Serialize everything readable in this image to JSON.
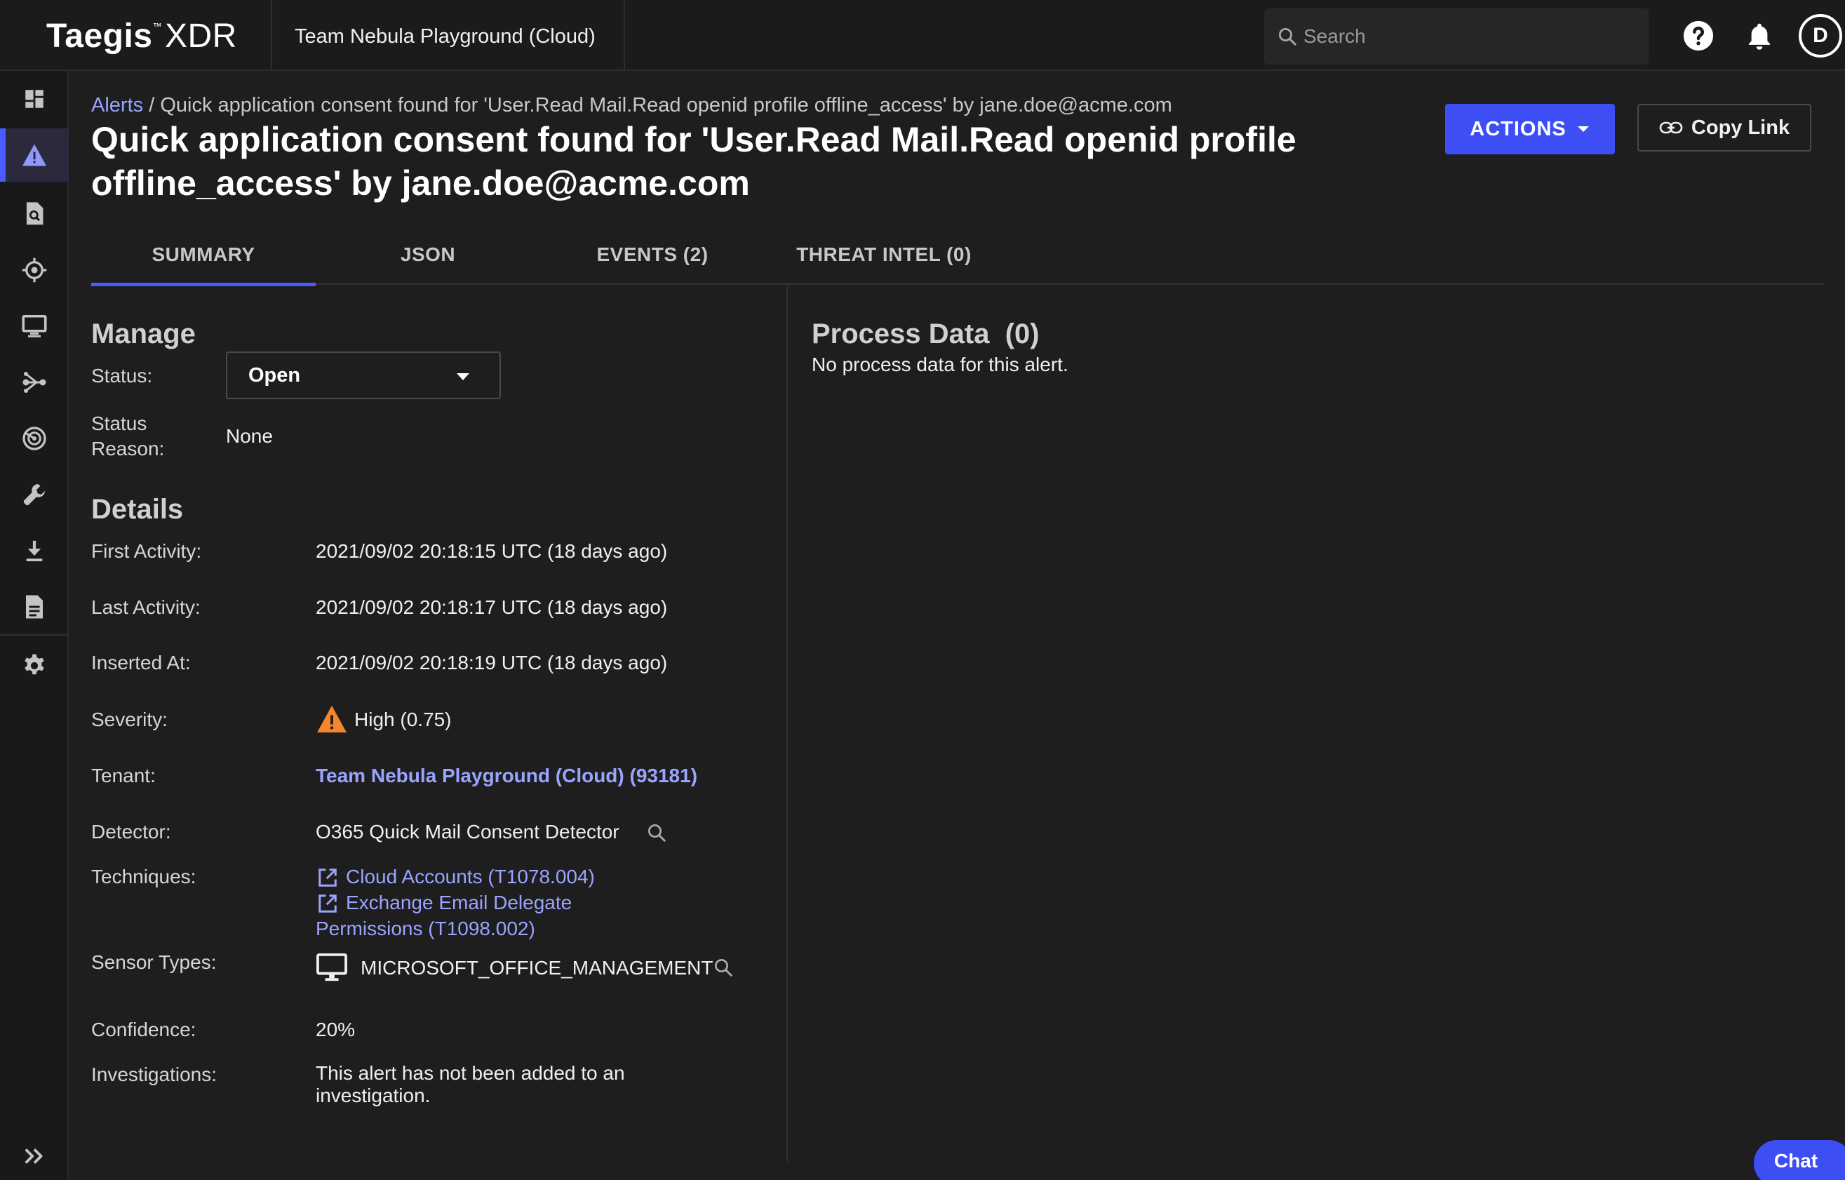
{
  "header": {
    "brand_primary": "Taegis",
    "brand_tm": "™",
    "brand_secondary": "XDR",
    "tenant_name": "Team Nebula Playground (Cloud)",
    "search_placeholder": "Search",
    "avatar_initial": "D"
  },
  "breadcrumb": {
    "root": "Alerts",
    "separator": " / ",
    "current": "Quick application consent found for 'User.Read Mail.Read openid profile offline_access' by jane.doe@acme.com"
  },
  "page": {
    "title": "Quick application consent found for 'User.Read Mail.Read openid profile offline_access' by jane.doe@acme.com",
    "actions_label": "ACTIONS",
    "copy_link_label": "Copy Link"
  },
  "tabs": [
    {
      "label": "SUMMARY",
      "active": true
    },
    {
      "label": "JSON",
      "active": false
    },
    {
      "label": "EVENTS (2)",
      "active": false
    },
    {
      "label": "THREAT INTEL (0)",
      "active": false
    }
  ],
  "manage": {
    "title": "Manage",
    "status_label": "Status:",
    "status_value": "Open",
    "status_reason_label_1": "Status",
    "status_reason_label_2": "Reason:",
    "status_reason_value": "None"
  },
  "details": {
    "title": "Details",
    "first_activity_label": "First Activity:",
    "first_activity": "2021/09/02 20:18:15 UTC (18 days ago)",
    "last_activity_label": "Last Activity:",
    "last_activity": "2021/09/02 20:18:17 UTC (18 days ago)",
    "inserted_at_label": "Inserted At:",
    "inserted_at": "2021/09/02 20:18:19 UTC (18 days ago)",
    "severity_label": "Severity:",
    "severity": "High (0.75)",
    "tenant_label": "Tenant:",
    "tenant": "Team Nebula Playground (Cloud) (93181)",
    "detector_label": "Detector:",
    "detector": "O365 Quick Mail Consent Detector",
    "techniques_label": "Techniques:",
    "technique_1": "Cloud Accounts (T1078.004)",
    "technique_2_line1": "Exchange Email Delegate",
    "technique_2_line2": "Permissions (T1098.002)",
    "sensor_types_label": "Sensor Types:",
    "sensor_type": "MICROSOFT_OFFICE_MANAGEMENT",
    "confidence_label": "Confidence:",
    "confidence": "20%",
    "investigations_label": "Investigations:",
    "investigations_line1": "This alert has not been added to an",
    "investigations_line2": "investigation."
  },
  "process_data": {
    "title": "Process Data  (0)",
    "empty_message": "No process data for this alert."
  },
  "chat": {
    "label": "Chat"
  },
  "colors": {
    "accent": "#3d4ef5",
    "link": "#9aa4ff",
    "severity_high": "#f5862b"
  }
}
